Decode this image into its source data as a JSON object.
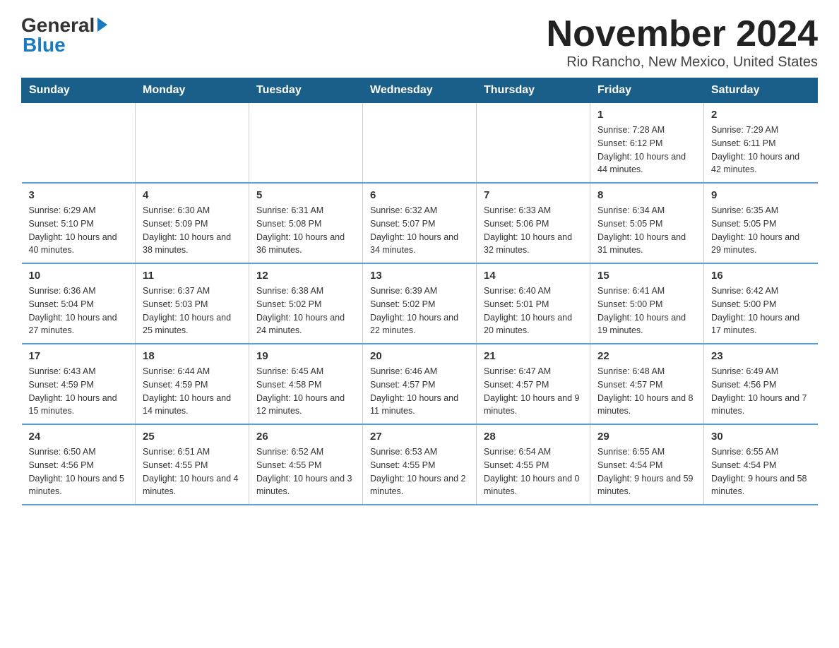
{
  "logo": {
    "line1_text": "General",
    "line2_text": "Blue"
  },
  "title": "November 2024",
  "subtitle": "Rio Rancho, New Mexico, United States",
  "days_of_week": [
    "Sunday",
    "Monday",
    "Tuesday",
    "Wednesday",
    "Thursday",
    "Friday",
    "Saturday"
  ],
  "weeks": [
    [
      {
        "day": "",
        "info": ""
      },
      {
        "day": "",
        "info": ""
      },
      {
        "day": "",
        "info": ""
      },
      {
        "day": "",
        "info": ""
      },
      {
        "day": "",
        "info": ""
      },
      {
        "day": "1",
        "info": "Sunrise: 7:28 AM\nSunset: 6:12 PM\nDaylight: 10 hours and 44 minutes."
      },
      {
        "day": "2",
        "info": "Sunrise: 7:29 AM\nSunset: 6:11 PM\nDaylight: 10 hours and 42 minutes."
      }
    ],
    [
      {
        "day": "3",
        "info": "Sunrise: 6:29 AM\nSunset: 5:10 PM\nDaylight: 10 hours and 40 minutes."
      },
      {
        "day": "4",
        "info": "Sunrise: 6:30 AM\nSunset: 5:09 PM\nDaylight: 10 hours and 38 minutes."
      },
      {
        "day": "5",
        "info": "Sunrise: 6:31 AM\nSunset: 5:08 PM\nDaylight: 10 hours and 36 minutes."
      },
      {
        "day": "6",
        "info": "Sunrise: 6:32 AM\nSunset: 5:07 PM\nDaylight: 10 hours and 34 minutes."
      },
      {
        "day": "7",
        "info": "Sunrise: 6:33 AM\nSunset: 5:06 PM\nDaylight: 10 hours and 32 minutes."
      },
      {
        "day": "8",
        "info": "Sunrise: 6:34 AM\nSunset: 5:05 PM\nDaylight: 10 hours and 31 minutes."
      },
      {
        "day": "9",
        "info": "Sunrise: 6:35 AM\nSunset: 5:05 PM\nDaylight: 10 hours and 29 minutes."
      }
    ],
    [
      {
        "day": "10",
        "info": "Sunrise: 6:36 AM\nSunset: 5:04 PM\nDaylight: 10 hours and 27 minutes."
      },
      {
        "day": "11",
        "info": "Sunrise: 6:37 AM\nSunset: 5:03 PM\nDaylight: 10 hours and 25 minutes."
      },
      {
        "day": "12",
        "info": "Sunrise: 6:38 AM\nSunset: 5:02 PM\nDaylight: 10 hours and 24 minutes."
      },
      {
        "day": "13",
        "info": "Sunrise: 6:39 AM\nSunset: 5:02 PM\nDaylight: 10 hours and 22 minutes."
      },
      {
        "day": "14",
        "info": "Sunrise: 6:40 AM\nSunset: 5:01 PM\nDaylight: 10 hours and 20 minutes."
      },
      {
        "day": "15",
        "info": "Sunrise: 6:41 AM\nSunset: 5:00 PM\nDaylight: 10 hours and 19 minutes."
      },
      {
        "day": "16",
        "info": "Sunrise: 6:42 AM\nSunset: 5:00 PM\nDaylight: 10 hours and 17 minutes."
      }
    ],
    [
      {
        "day": "17",
        "info": "Sunrise: 6:43 AM\nSunset: 4:59 PM\nDaylight: 10 hours and 15 minutes."
      },
      {
        "day": "18",
        "info": "Sunrise: 6:44 AM\nSunset: 4:59 PM\nDaylight: 10 hours and 14 minutes."
      },
      {
        "day": "19",
        "info": "Sunrise: 6:45 AM\nSunset: 4:58 PM\nDaylight: 10 hours and 12 minutes."
      },
      {
        "day": "20",
        "info": "Sunrise: 6:46 AM\nSunset: 4:57 PM\nDaylight: 10 hours and 11 minutes."
      },
      {
        "day": "21",
        "info": "Sunrise: 6:47 AM\nSunset: 4:57 PM\nDaylight: 10 hours and 9 minutes."
      },
      {
        "day": "22",
        "info": "Sunrise: 6:48 AM\nSunset: 4:57 PM\nDaylight: 10 hours and 8 minutes."
      },
      {
        "day": "23",
        "info": "Sunrise: 6:49 AM\nSunset: 4:56 PM\nDaylight: 10 hours and 7 minutes."
      }
    ],
    [
      {
        "day": "24",
        "info": "Sunrise: 6:50 AM\nSunset: 4:56 PM\nDaylight: 10 hours and 5 minutes."
      },
      {
        "day": "25",
        "info": "Sunrise: 6:51 AM\nSunset: 4:55 PM\nDaylight: 10 hours and 4 minutes."
      },
      {
        "day": "26",
        "info": "Sunrise: 6:52 AM\nSunset: 4:55 PM\nDaylight: 10 hours and 3 minutes."
      },
      {
        "day": "27",
        "info": "Sunrise: 6:53 AM\nSunset: 4:55 PM\nDaylight: 10 hours and 2 minutes."
      },
      {
        "day": "28",
        "info": "Sunrise: 6:54 AM\nSunset: 4:55 PM\nDaylight: 10 hours and 0 minutes."
      },
      {
        "day": "29",
        "info": "Sunrise: 6:55 AM\nSunset: 4:54 PM\nDaylight: 9 hours and 59 minutes."
      },
      {
        "day": "30",
        "info": "Sunrise: 6:55 AM\nSunset: 4:54 PM\nDaylight: 9 hours and 58 minutes."
      }
    ]
  ]
}
